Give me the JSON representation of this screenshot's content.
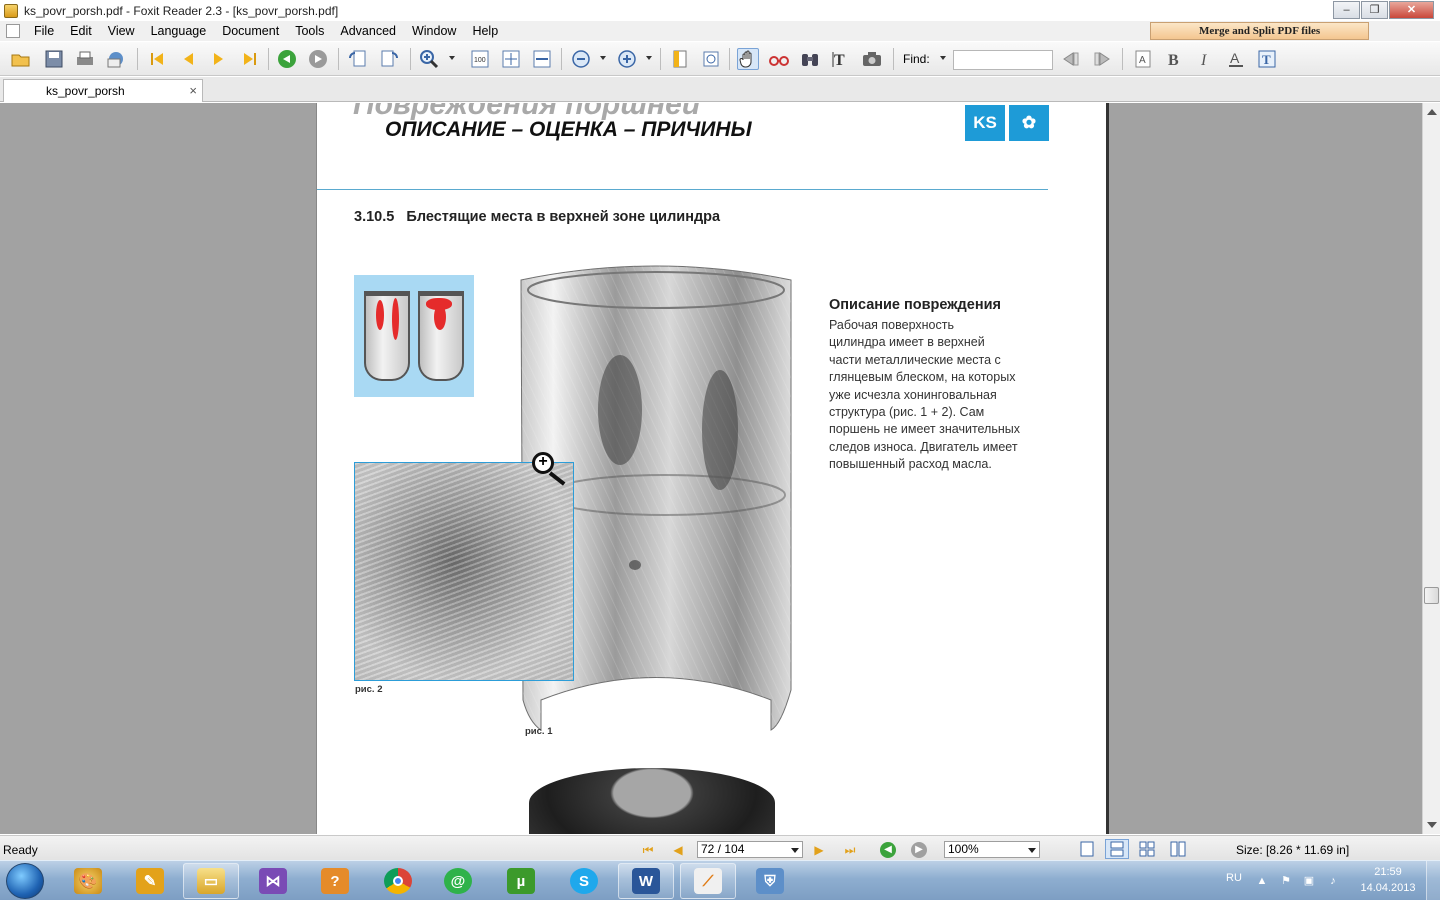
{
  "window": {
    "title": "ks_povr_porsh.pdf - Foxit Reader 2.3 - [ks_povr_porsh.pdf]",
    "minimize": "‒",
    "restore": "❐",
    "close": "✕"
  },
  "menu": {
    "items": [
      "File",
      "Edit",
      "View",
      "Language",
      "Document",
      "Tools",
      "Advanced",
      "Window",
      "Help"
    ],
    "promo": "Merge and Split PDF files"
  },
  "toolbar": {
    "find_label": "Find:",
    "find_value": "",
    "icons": [
      "open-icon",
      "save-icon",
      "print-icon",
      "email-icon",
      "first-page-icon",
      "previous-page-icon",
      "next-page-icon",
      "last-page-icon",
      "go-back-icon",
      "go-forward-icon",
      "rotate-left-icon",
      "rotate-right-icon",
      "zoom-in-icon",
      "actual-size-icon",
      "fit-page-icon",
      "fit-width-icon",
      "zoom-out-icon",
      "zoom-plus-icon",
      "bookmark-icon",
      "snapshot-page-icon",
      "hand-tool-icon",
      "reading-glasses-icon",
      "binoculars-icon",
      "select-text-icon",
      "camera-icon",
      "find-previous-icon",
      "find-next-icon",
      "text-box-icon",
      "bold-icon",
      "italic-icon",
      "underline-text-icon",
      "typewriter-icon"
    ]
  },
  "tab": {
    "label": "ks_povr_porsh",
    "close": "×"
  },
  "document": {
    "header_ghost": "Повреждения поршней",
    "header_title": "ОПИСАНИЕ – ОЦЕНКА – ПРИЧИНЫ",
    "logo_left": "KS",
    "logo_right": "✿",
    "section_number": "3.10.5",
    "section_title": "Блестящие места в верхней зоне цилиндра",
    "caption_fig2": "рис. 2",
    "caption_fig1": "рис. 1",
    "description_heading": "Описание повреждения",
    "description_lines": [
      "Рабочая поверхность",
      "цилиндра имеет в верхней",
      "части металлические места с",
      "глянцевым блеском, на которых",
      "уже исчезла хонинговальная",
      "структура (рис. 1 + 2). Сам",
      "поршень не имеет значительных",
      "следов износа. Двигатель имеет",
      "повышенный расход масла."
    ]
  },
  "statusbar": {
    "status": "Ready",
    "page_value": "72 / 104",
    "zoom_value": "100%",
    "size": "Size: [8.26 * 11.69 in]"
  },
  "taskbar": {
    "apps": [
      "paint-icon",
      "foxit-icon",
      "file-explorer-icon",
      "visual-studio-icon",
      "installer-icon",
      "chrome-icon",
      "mail-agent-icon",
      "utorrent-icon",
      "skype-icon",
      "word-icon",
      "foxit-reader-icon",
      "network-icon"
    ],
    "language": "RU",
    "time": "21:59",
    "date": "14.04.2013"
  },
  "colors": {
    "accent_blue": "#1e9bd7",
    "highlight_red": "#e52b2b",
    "viewer_bg": "#a2a2a2"
  }
}
